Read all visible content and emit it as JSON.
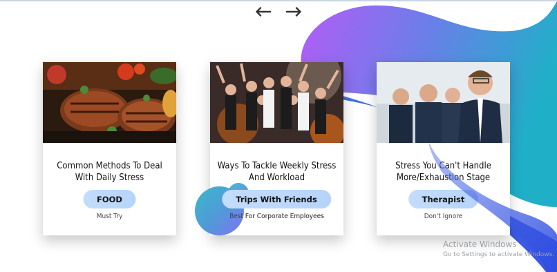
{
  "nav": {
    "prev_icon": "arrow-left-icon",
    "next_icon": "arrow-right-icon"
  },
  "cards": [
    {
      "title": "Common Methods To Deal With Daily Stress",
      "button": "FOOD",
      "subtitle": "Must Try",
      "image": "grilled-steak-photo"
    },
    {
      "title": "Ways To Tackle Weekly Stress And Workload",
      "button": "Trips With Friends",
      "subtitle": "Best For Corporate Employees",
      "image": "party-friends-photo"
    },
    {
      "title": "Stress You Can't Handle More/Exhaustion Stage",
      "button": "Therapist",
      "subtitle": "Don't Ignore",
      "image": "business-people-photo"
    }
  ],
  "watermark": {
    "line1": "Activate Windows",
    "line2": "Go to Settings to activate Windows."
  },
  "colors": {
    "blob_start": "#b45cf6",
    "blob_mid": "#6a7fe8",
    "blob_end": "#1fb0c8",
    "button": "#bcd7fa"
  }
}
